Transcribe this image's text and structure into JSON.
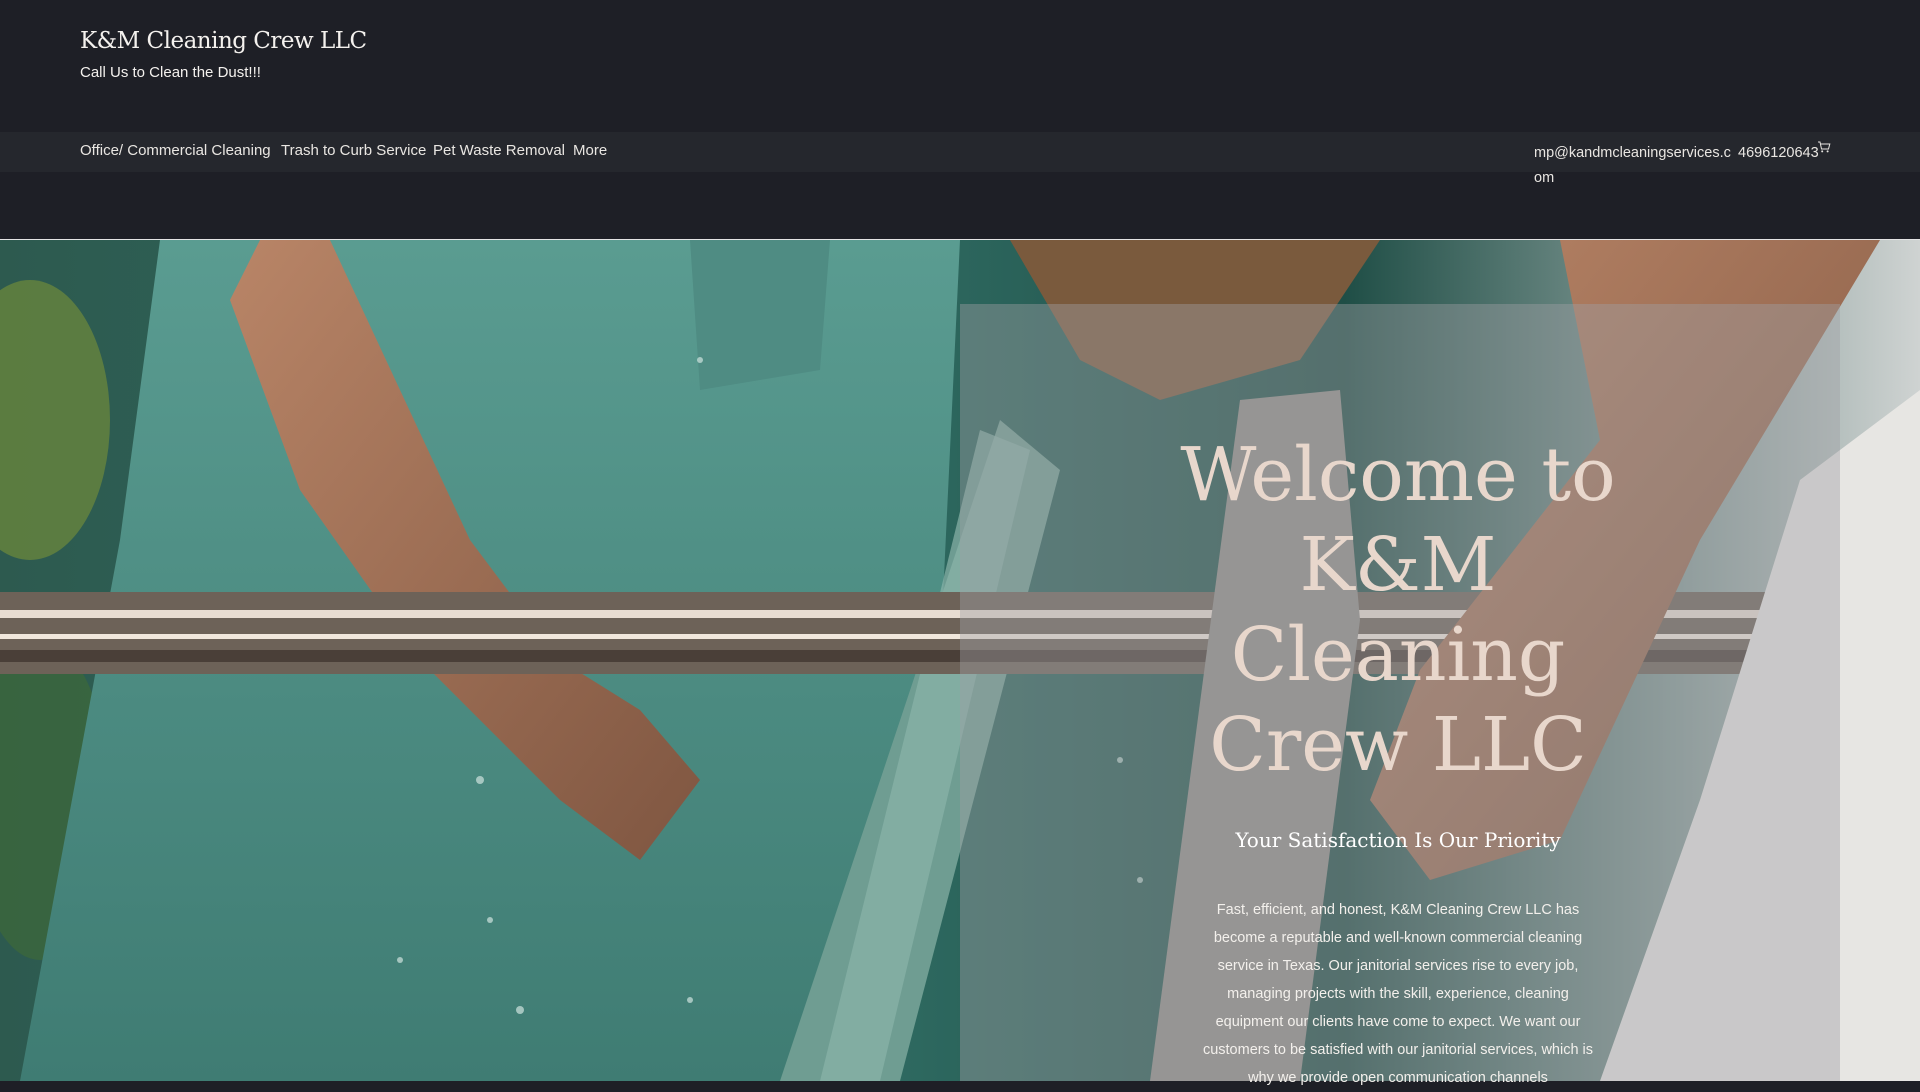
{
  "site": {
    "title": "K&M Cleaning Crew LLC",
    "tagline": "Call Us to Clean the Dust!!!"
  },
  "nav": {
    "items": [
      {
        "label": "Office/ Commercial Cleaning"
      },
      {
        "label": "Trash to Curb Service"
      },
      {
        "label": "Pet Waste Removal"
      },
      {
        "label": "More"
      }
    ]
  },
  "contact": {
    "email": "mp@kandmcleaningservices.com",
    "phone": "4696120643",
    "cart_icon": "cart-icon"
  },
  "hero": {
    "heading": "Welcome to K&M Cleaning Crew LLC",
    "subheading": "Your Satisfaction Is Our Priority",
    "body": "Fast, efficient, and honest, K&M Cleaning Crew LLC has become a reputable and well-known commercial cleaning service in Texas. Our janitorial services rise to every job, managing projects with the skill, experience, cleaning equipment our clients have come to expect. We want our customers to be satisfied with our janitorial services, which is why we provide open communication channels"
  },
  "colors": {
    "background": "#1e1f26",
    "nav_background": "#25272d",
    "heading": "#e8d7cc",
    "text": "#f4f1ee"
  }
}
